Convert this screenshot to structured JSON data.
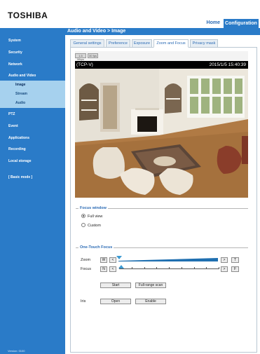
{
  "header": {
    "logo": "TOSHIBA",
    "home": "Home",
    "configuration": "Configuration"
  },
  "breadcrumb": "Audio and Video > Image",
  "sidebar": {
    "items": [
      {
        "label": "System"
      },
      {
        "label": "Security"
      },
      {
        "label": "Network"
      },
      {
        "label": "Audio and Video"
      },
      {
        "label": "PTZ"
      },
      {
        "label": "Event"
      },
      {
        "label": "Applications"
      },
      {
        "label": "Recording"
      },
      {
        "label": "Local storage"
      },
      {
        "label": "[ Basic mode ]"
      }
    ],
    "sub_items": [
      {
        "label": "Image",
        "active": true
      },
      {
        "label": "Stream",
        "active": false
      },
      {
        "label": "Audio",
        "active": false
      }
    ],
    "version": "Version: 0100"
  },
  "tabs": [
    {
      "label": "General settings",
      "active": false
    },
    {
      "label": "Preference",
      "active": false
    },
    {
      "label": "Exposure",
      "active": false
    },
    {
      "label": "Zoom and Focus",
      "active": true
    },
    {
      "label": "Privacy mask",
      "active": false
    }
  ],
  "video": {
    "stream_buttons": [
      "1.5 Mbps",
      "30 fps"
    ],
    "camera_name": "(TCP-V)",
    "timestamp": "2015/1/5 15:40:39"
  },
  "focus_window": {
    "title": "Focus window",
    "options": [
      {
        "label": "Full view",
        "selected": true
      },
      {
        "label": "Custom",
        "selected": false
      }
    ]
  },
  "one_touch_focus": {
    "title": "One-Touch Focus",
    "zoom": {
      "label": "Zoom",
      "left_button": "W",
      "step_down": "<",
      "step_up": ">",
      "right_button": "T",
      "level": 0.0
    },
    "focus": {
      "label": "Focus",
      "left_button": "N",
      "step_down": "<",
      "step_up": ">",
      "right_button": "F",
      "level": 0.0
    },
    "start": "Start",
    "full_range_scan": "Full-range scan",
    "iris": {
      "label": "Iris",
      "open": "Open",
      "enable": "Enable"
    }
  },
  "colors": {
    "accent": "#2a7bc8",
    "sub_item_bg": "#a6d1ee",
    "link": "#2d6cb5",
    "slider_thumb": "#3c9ad2"
  }
}
